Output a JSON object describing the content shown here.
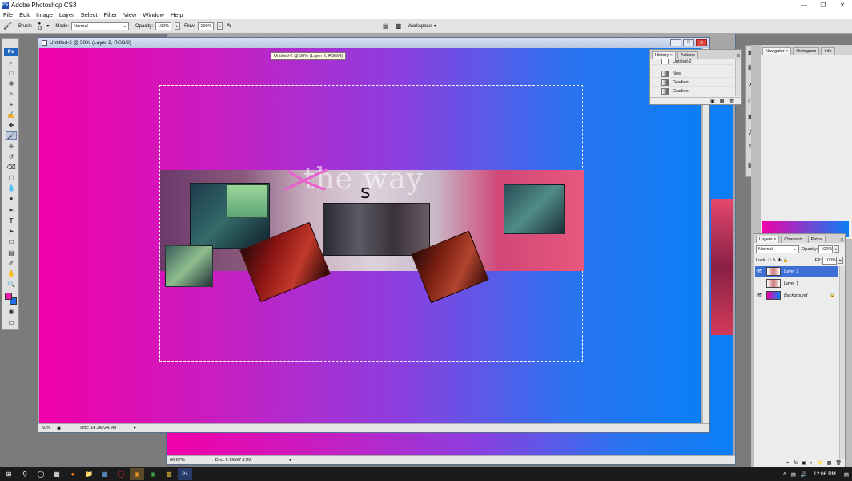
{
  "app": {
    "title": "Adobe Photoshop CS3",
    "icon_text": "Ps"
  },
  "menu": [
    "File",
    "Edit",
    "Image",
    "Layer",
    "Select",
    "Filter",
    "View",
    "Window",
    "Help"
  ],
  "options_bar": {
    "brush_label": "Brush:",
    "brush_size": "13",
    "mode_label": "Mode:",
    "mode_value": "Normal",
    "opacity_label": "Opacity:",
    "opacity_value": "100%",
    "flow_label": "Flow:",
    "flow_value": "100%",
    "workspace_label": "Workspace"
  },
  "toolbox": {
    "logo": "Ps"
  },
  "doc_main": {
    "title": "Untitled-2 @ 50% (Layer 2, RGB/8)",
    "tooltip": "Untitled-2 @ 50% (Layer 2, RGB/8)",
    "zoom": "50%",
    "doc_size": "Doc: 14.3M/24.9M",
    "overlay_text": "the way",
    "overlay_letter": "s"
  },
  "doc_back": {
    "zoom": "66.67%",
    "doc_size": "Doc: 6.79M/7.17M"
  },
  "history_panel": {
    "tabs": [
      "History",
      "Actions"
    ],
    "snapshot": "Untitled-2",
    "items": [
      "New",
      "Gradient",
      "Gradient"
    ]
  },
  "navigator_panel": {
    "tabs": [
      "Navigator",
      "Histogram",
      "Info"
    ]
  },
  "layers_panel": {
    "tabs": [
      "Layers",
      "Channels",
      "Paths"
    ],
    "blend_mode": "Normal",
    "opacity_label": "Opacity:",
    "opacity_value": "100%",
    "lock_label": "Lock:",
    "fill_label": "Fill:",
    "fill_value": "100%",
    "layers": [
      {
        "name": "Layer 2",
        "selected": true,
        "visible": true
      },
      {
        "name": "Layer 1",
        "selected": false,
        "visible": false
      },
      {
        "name": "Background",
        "selected": false,
        "visible": true
      }
    ]
  },
  "taskbar": {
    "time": "12:06 PM"
  },
  "colors": {
    "foreground": "#ee1aa9",
    "background": "#1f6fe0",
    "gradient_start": "#f200a8",
    "gradient_end": "#0a7ff5",
    "selection": "#3d6fd4"
  }
}
